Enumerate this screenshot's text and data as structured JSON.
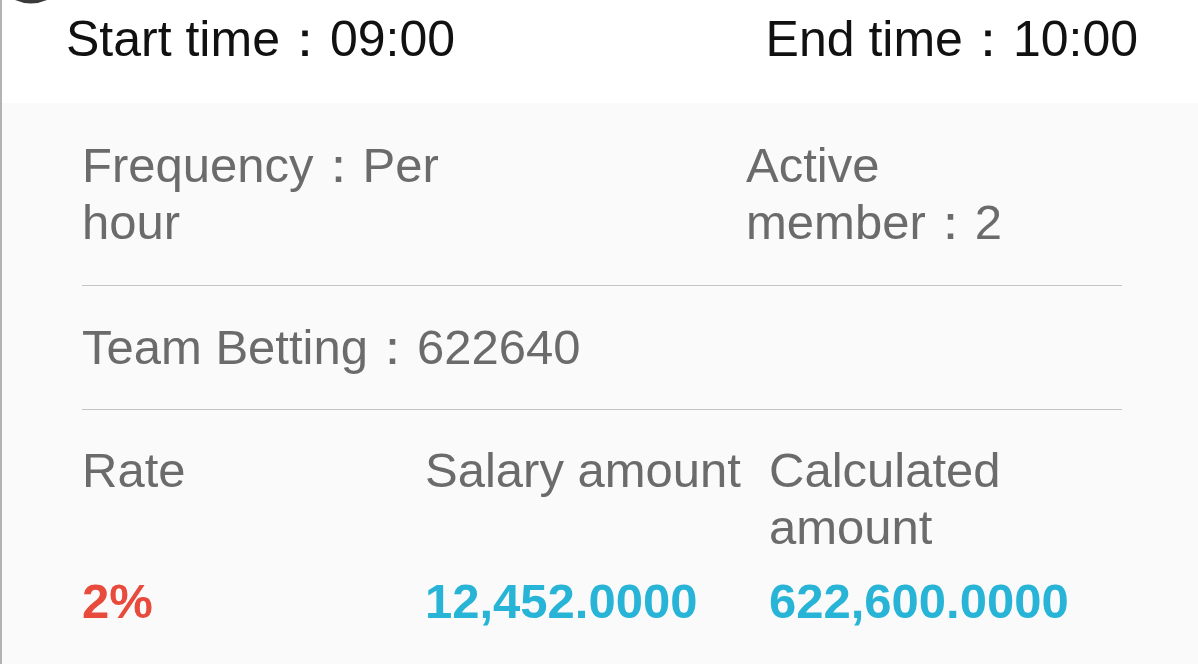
{
  "header": {
    "start_time": "Start time：09:00",
    "end_time": "End time：10:00"
  },
  "summary": {
    "frequency": "Frequency：Per hour",
    "active_member": "Active member：2",
    "team_betting": "Team Betting：622640"
  },
  "table": {
    "columns": [
      "Rate",
      "Salary amount",
      "Calculated amount"
    ],
    "rows": [
      {
        "cells": [
          {
            "text": "2%",
            "color": "#e84a3c"
          },
          {
            "text": "12,452.0000",
            "color": "#27b4d6"
          },
          {
            "text": "622,600.0000",
            "color": "#27b4d6"
          }
        ]
      }
    ]
  }
}
